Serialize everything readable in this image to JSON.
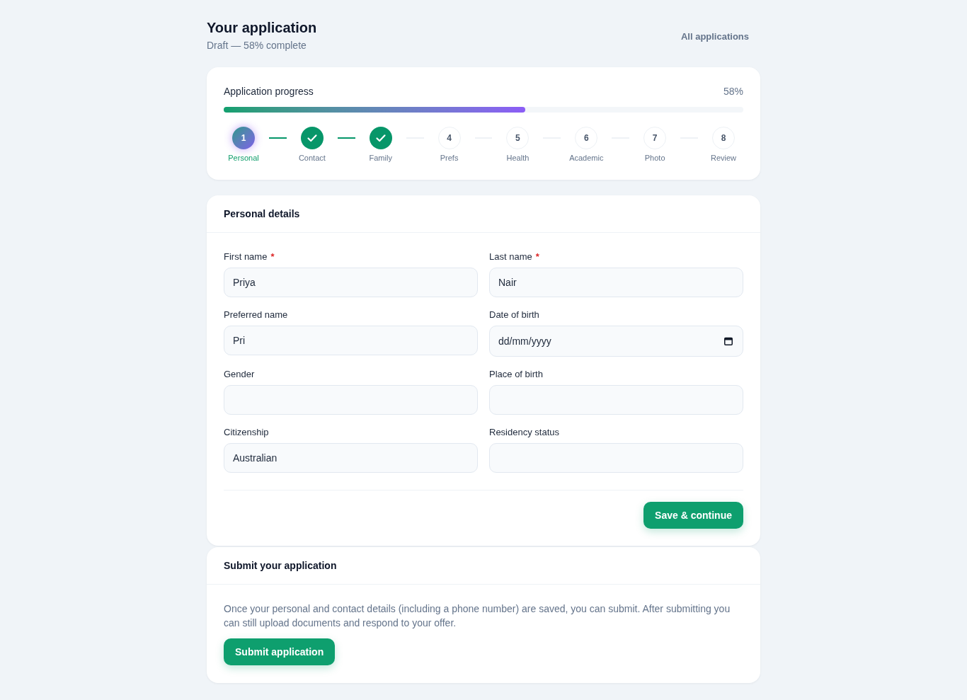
{
  "header": {
    "title": "Your application",
    "subtitle": "Draft — 58% complete",
    "link": "All applications"
  },
  "progress": {
    "title": "Application progress",
    "percent": "58%",
    "level": 0.58,
    "steps": [
      {
        "label": "Personal",
        "number": "1",
        "selected": true,
        "done": false
      },
      {
        "label": "Contact",
        "selected": false,
        "done": true
      },
      {
        "label": "Family",
        "selected": false,
        "done": true
      },
      {
        "label": "Prefs",
        "number": "4",
        "selected": false,
        "done": false
      },
      {
        "label": "Health",
        "number": "5",
        "selected": false,
        "done": false
      },
      {
        "label": "Academic",
        "number": "6",
        "selected": false,
        "done": false
      },
      {
        "label": "Photo",
        "number": "7",
        "selected": false,
        "done": false
      },
      {
        "label": "Review",
        "number": "8",
        "selected": false,
        "done": false
      }
    ]
  },
  "personal_details": {
    "title": "Personal details",
    "fields": [
      {
        "label": "First name",
        "required_mark": "*",
        "kind": "text",
        "value": "Priya"
      },
      {
        "label": "Last name",
        "required_mark": "*",
        "kind": "text",
        "value": "Nair"
      },
      {
        "label": "Preferred name",
        "kind": "text",
        "value": "Pri"
      },
      {
        "label": "Date of birth",
        "kind": "date",
        "placeholder": "dd/mm/yyyy"
      },
      {
        "label": "Gender",
        "kind": "text"
      },
      {
        "label": "Place of birth",
        "kind": "text"
      },
      {
        "label": "Citizenship",
        "kind": "text",
        "value": "Australian"
      },
      {
        "label": "Residency status",
        "kind": "text"
      }
    ],
    "button": "Save & continue"
  },
  "submit": {
    "title": "Submit your application",
    "text": "Once your personal and contact details (including a phone number) are saved, you can submit. After submitting you can still upload documents and respond to your offer.",
    "button": "Submit application"
  }
}
